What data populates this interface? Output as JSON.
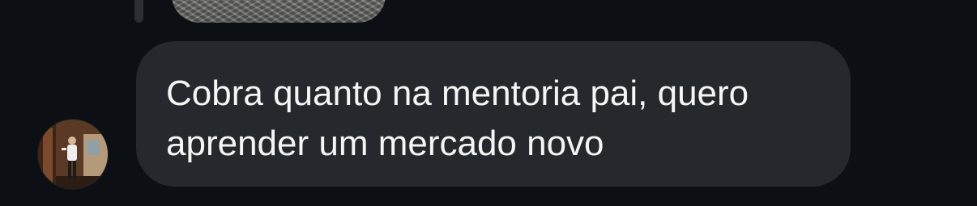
{
  "thread": {
    "previous_message": {
      "kind": "media",
      "icon": "image-thumbnail"
    },
    "message": {
      "sender_avatar": "avatar-photo",
      "text": "Cobra quanto na mentoria pai, quero aprender um mercado novo"
    }
  },
  "colors": {
    "background": "#0c1014",
    "bubble": "#25292d",
    "text": "#f5f5f5"
  }
}
